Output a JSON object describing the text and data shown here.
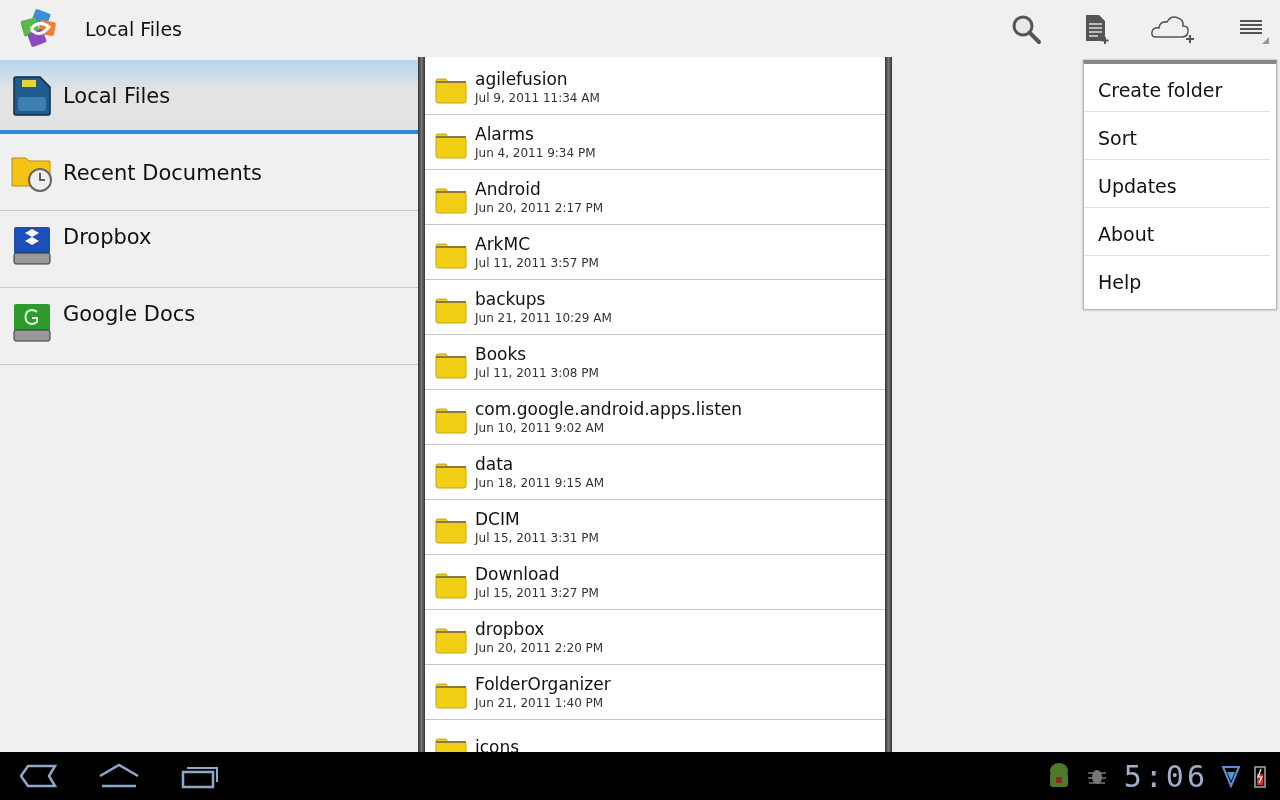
{
  "action_bar": {
    "title": "Local Files"
  },
  "sidebar": {
    "items": [
      {
        "label": "Local Files",
        "kind": "sdcard",
        "selected": true
      },
      {
        "label": "Recent Documents",
        "kind": "recent",
        "selected": false
      },
      {
        "label": "Dropbox",
        "kind": "dropbox",
        "selected": false
      },
      {
        "label": "Google Docs",
        "kind": "gdocs",
        "selected": false
      }
    ]
  },
  "files": [
    {
      "name": "agilefusion",
      "date": "Jul 9, 2011 11:34 AM"
    },
    {
      "name": "Alarms",
      "date": "Jun 4, 2011 9:34 PM"
    },
    {
      "name": "Android",
      "date": "Jun 20, 2011 2:17 PM"
    },
    {
      "name": "ArkMC",
      "date": "Jul 11, 2011 3:57 PM"
    },
    {
      "name": "backups",
      "date": "Jun 21, 2011 10:29 AM"
    },
    {
      "name": "Books",
      "date": "Jul 11, 2011 3:08 PM"
    },
    {
      "name": "com.google.android.apps.listen",
      "date": "Jun 10, 2011 9:02 AM"
    },
    {
      "name": "data",
      "date": "Jun 18, 2011 9:15 AM"
    },
    {
      "name": "DCIM",
      "date": "Jul 15, 2011 3:31 PM"
    },
    {
      "name": "Download",
      "date": "Jul 15, 2011 3:27 PM"
    },
    {
      "name": "dropbox",
      "date": "Jun 20, 2011 2:20 PM"
    },
    {
      "name": "FolderOrganizer",
      "date": "Jun 21, 2011 1:40 PM"
    },
    {
      "name": "icons"
    }
  ],
  "overflow_menu": {
    "items": [
      "Create folder",
      "Sort",
      "Updates",
      "About",
      "Help"
    ]
  },
  "system_bar": {
    "time": "5:06"
  }
}
